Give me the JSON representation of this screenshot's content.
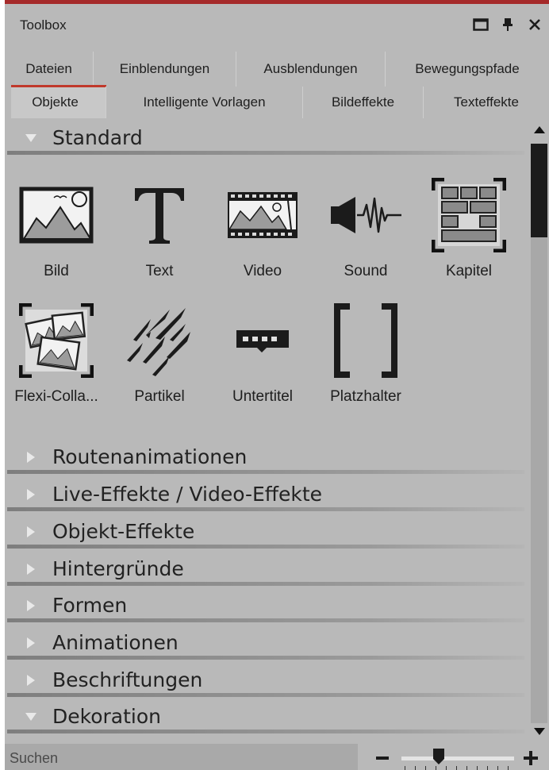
{
  "window": {
    "title": "Toolbox"
  },
  "tabs_row1": [
    {
      "label": "Dateien"
    },
    {
      "label": "Einblendungen"
    },
    {
      "label": "Ausblendungen"
    },
    {
      "label": "Bewegungspfade"
    }
  ],
  "tabs_row2": [
    {
      "label": "Objekte",
      "active": true
    },
    {
      "label": "Intelligente Vorlagen"
    },
    {
      "label": "Bildeffekte"
    },
    {
      "label": "Texteffekte"
    }
  ],
  "sections": {
    "standard": {
      "label": "Standard",
      "expanded": true
    },
    "collapsed": [
      {
        "label": "Routenanimationen"
      },
      {
        "label": "Live-Effekte / Video-Effekte"
      },
      {
        "label": "Objekt-Effekte"
      },
      {
        "label": "Hintergründe"
      },
      {
        "label": "Formen"
      },
      {
        "label": "Animationen"
      },
      {
        "label": "Beschriftungen"
      }
    ],
    "dekoration": {
      "label": "Dekoration",
      "expanded": true
    }
  },
  "items": [
    {
      "label": "Bild",
      "icon": "image-icon"
    },
    {
      "label": "Text",
      "icon": "text-icon"
    },
    {
      "label": "Video",
      "icon": "video-icon"
    },
    {
      "label": "Sound",
      "icon": "sound-icon"
    },
    {
      "label": "Kapitel",
      "icon": "chapter-icon"
    },
    {
      "label": "Flexi-Colla...",
      "icon": "flexi-collage-icon"
    },
    {
      "label": "Partikel",
      "icon": "particle-icon"
    },
    {
      "label": "Untertitel",
      "icon": "subtitle-icon"
    },
    {
      "label": "Platzhalter",
      "icon": "placeholder-icon"
    }
  ],
  "search": {
    "placeholder": "Suchen",
    "value": ""
  },
  "colors": {
    "accent": "#a52a2a",
    "panel": "#b9b9b9"
  }
}
